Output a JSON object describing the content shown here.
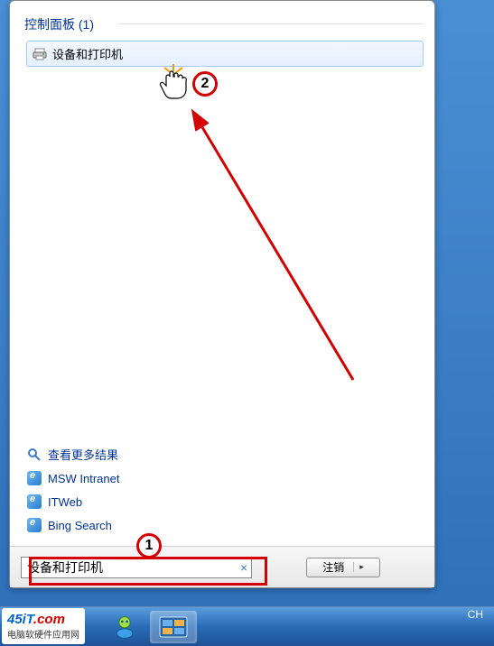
{
  "heading": {
    "label": "控制面板 (1)"
  },
  "result": {
    "label": "设备和打印机"
  },
  "links": {
    "more_results": "查看更多结果",
    "items": [
      {
        "label": "MSW Intranet"
      },
      {
        "label": "ITWeb"
      },
      {
        "label": "Bing Search"
      }
    ]
  },
  "search": {
    "value": "设备和打印机",
    "clear_symbol": "×"
  },
  "logoff": {
    "label": "注销"
  },
  "annotations": {
    "badge1": "1",
    "badge2": "2"
  },
  "ime": {
    "label": "CH"
  },
  "watermark": {
    "main_prefix": "45iT",
    "main_suffix": ".com",
    "sub": "电脑软硬件应用网"
  }
}
